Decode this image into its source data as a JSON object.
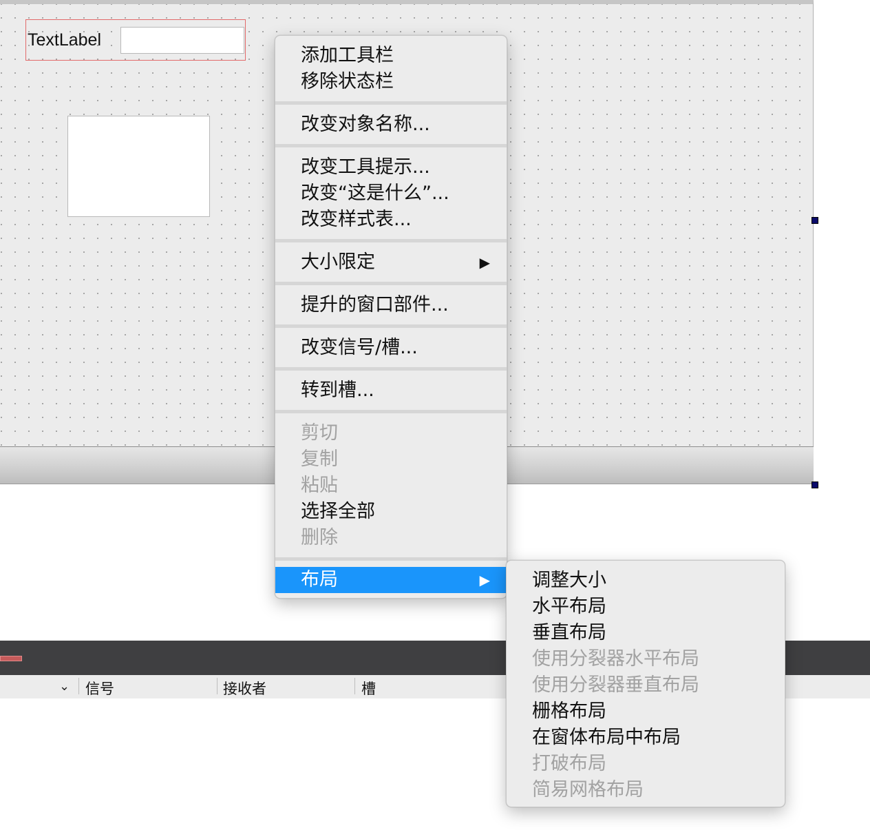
{
  "form": {
    "text_label": "TextLabel"
  },
  "context_menu": {
    "items": [
      {
        "label": "添加工具栏",
        "enabled": true
      },
      {
        "label": "移除状态栏",
        "enabled": true
      },
      {
        "label": "改变对象名称...",
        "enabled": true
      },
      {
        "label": "改变工具提示...",
        "enabled": true
      },
      {
        "label": "改变“这是什么”...",
        "enabled": true
      },
      {
        "label": "改变样式表...",
        "enabled": true
      },
      {
        "label": "大小限定",
        "enabled": true,
        "submenu_arrow": "▶"
      },
      {
        "label": "提升的窗口部件...",
        "enabled": true
      },
      {
        "label": "改变信号/槽...",
        "enabled": true
      },
      {
        "label": "转到槽...",
        "enabled": true
      },
      {
        "label": "剪切",
        "enabled": false
      },
      {
        "label": "复制",
        "enabled": false
      },
      {
        "label": "粘贴",
        "enabled": false
      },
      {
        "label": "选择全部",
        "enabled": true
      },
      {
        "label": "删除",
        "enabled": false
      },
      {
        "label": "布局",
        "enabled": true,
        "highlighted": true,
        "submenu_arrow": "▶"
      }
    ]
  },
  "layout_submenu": {
    "items": [
      {
        "label": "调整大小",
        "enabled": true
      },
      {
        "label": "水平布局",
        "enabled": true
      },
      {
        "label": "垂直布局",
        "enabled": true
      },
      {
        "label": "使用分裂器水平布局",
        "enabled": false
      },
      {
        "label": "使用分裂器垂直布局",
        "enabled": false
      },
      {
        "label": "栅格布局",
        "enabled": true
      },
      {
        "label": "在窗体布局中布局",
        "enabled": true
      },
      {
        "label": "打破布局",
        "enabled": false
      },
      {
        "label": "简易网格布局",
        "enabled": false
      }
    ]
  },
  "signal_slot_table": {
    "chevron": "⌄",
    "columns": [
      "信号",
      "接收者",
      "槽"
    ]
  },
  "colors": {
    "highlight": "#1a95fb",
    "disabled_text": "#a2a2a2",
    "dock_background": "#3f3f41"
  }
}
